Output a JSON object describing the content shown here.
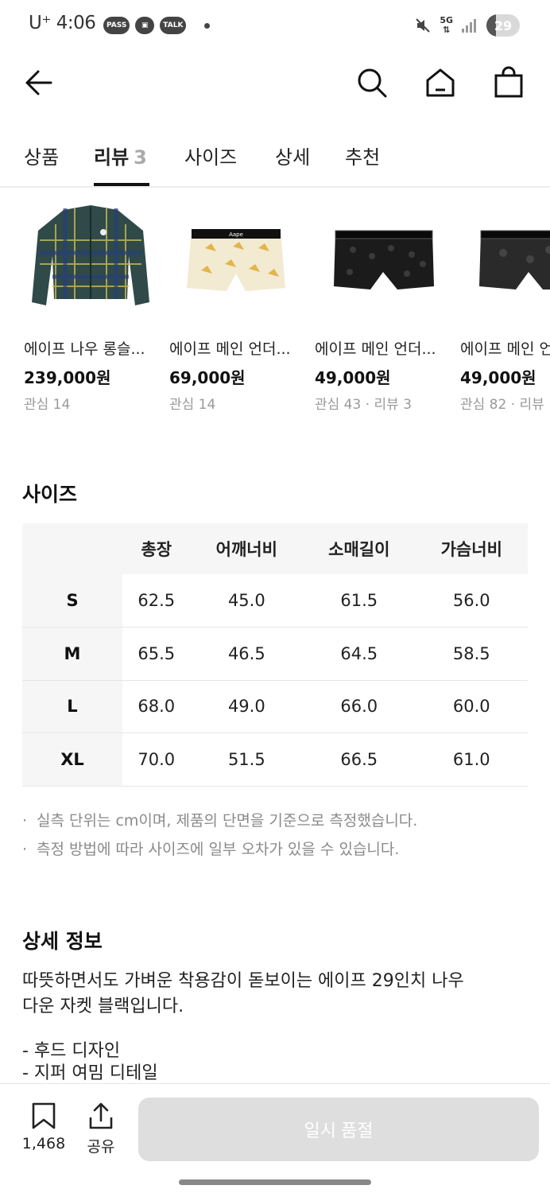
{
  "status_bar": {
    "carrier_time": "U⁺ 4:06",
    "badges": [
      "PASS",
      "▣",
      "TALK"
    ],
    "network": "5G",
    "battery_text": "29",
    "battery_level": 0.29
  },
  "tabs": [
    {
      "label": "상품",
      "count": ""
    },
    {
      "label": "리뷰",
      "count": "3",
      "active": true
    },
    {
      "label": "사이즈",
      "count": ""
    },
    {
      "label": "상세",
      "count": ""
    },
    {
      "label": "추천",
      "count": ""
    }
  ],
  "products": [
    {
      "name": "에이프 나우 롱슬...",
      "price": "239,000원",
      "meta": "관심 14",
      "image": "plaid-shirt"
    },
    {
      "name": "에이프 메인 언더...",
      "price": "69,000원",
      "meta": "관심 14",
      "image": "cream-boxer"
    },
    {
      "name": "에이프 메인 언더...",
      "price": "49,000원",
      "meta": "관심 43 · 리뷰 3",
      "image": "black-trunk"
    },
    {
      "name": "에이프 메인 언더...",
      "price": "49,000원",
      "meta": "관심 82 · 리뷰",
      "image": "black-trunk-2"
    }
  ],
  "size_section": {
    "title": "사이즈",
    "columns": [
      "",
      "총장",
      "어깨너비",
      "소매길이",
      "가슴너비"
    ],
    "rows": [
      {
        "size": "S",
        "values": [
          "62.5",
          "45.0",
          "61.5",
          "56.0"
        ]
      },
      {
        "size": "M",
        "values": [
          "65.5",
          "46.5",
          "64.5",
          "58.5"
        ]
      },
      {
        "size": "L",
        "values": [
          "68.0",
          "49.0",
          "66.0",
          "60.0"
        ]
      },
      {
        "size": "XL",
        "values": [
          "70.0",
          "51.5",
          "66.5",
          "61.0"
        ]
      }
    ],
    "notes": [
      "실측 단위는 cm이며, 제품의 단면을 기준으로 측정했습니다.",
      "측정 방법에 따라 사이즈에 일부 오차가 있을 수 있습니다."
    ]
  },
  "detail_section": {
    "title": "상세 정보",
    "description_line1": "따뜻하면서도 가벼운 착용감이 돋보이는 에이프 29인치 나우",
    "description_line2": "다운 자켓 블랙입니다.",
    "features": [
      "- 후드 디자인",
      "- 지퍼 여밈 디테일"
    ]
  },
  "bottom_bar": {
    "wishlist_count": "1,468",
    "share_label": "공유",
    "buy_label": "일시 품절"
  },
  "colors": {
    "accent": "#111111",
    "muted": "#999999",
    "disabled_button": "#dedede"
  }
}
